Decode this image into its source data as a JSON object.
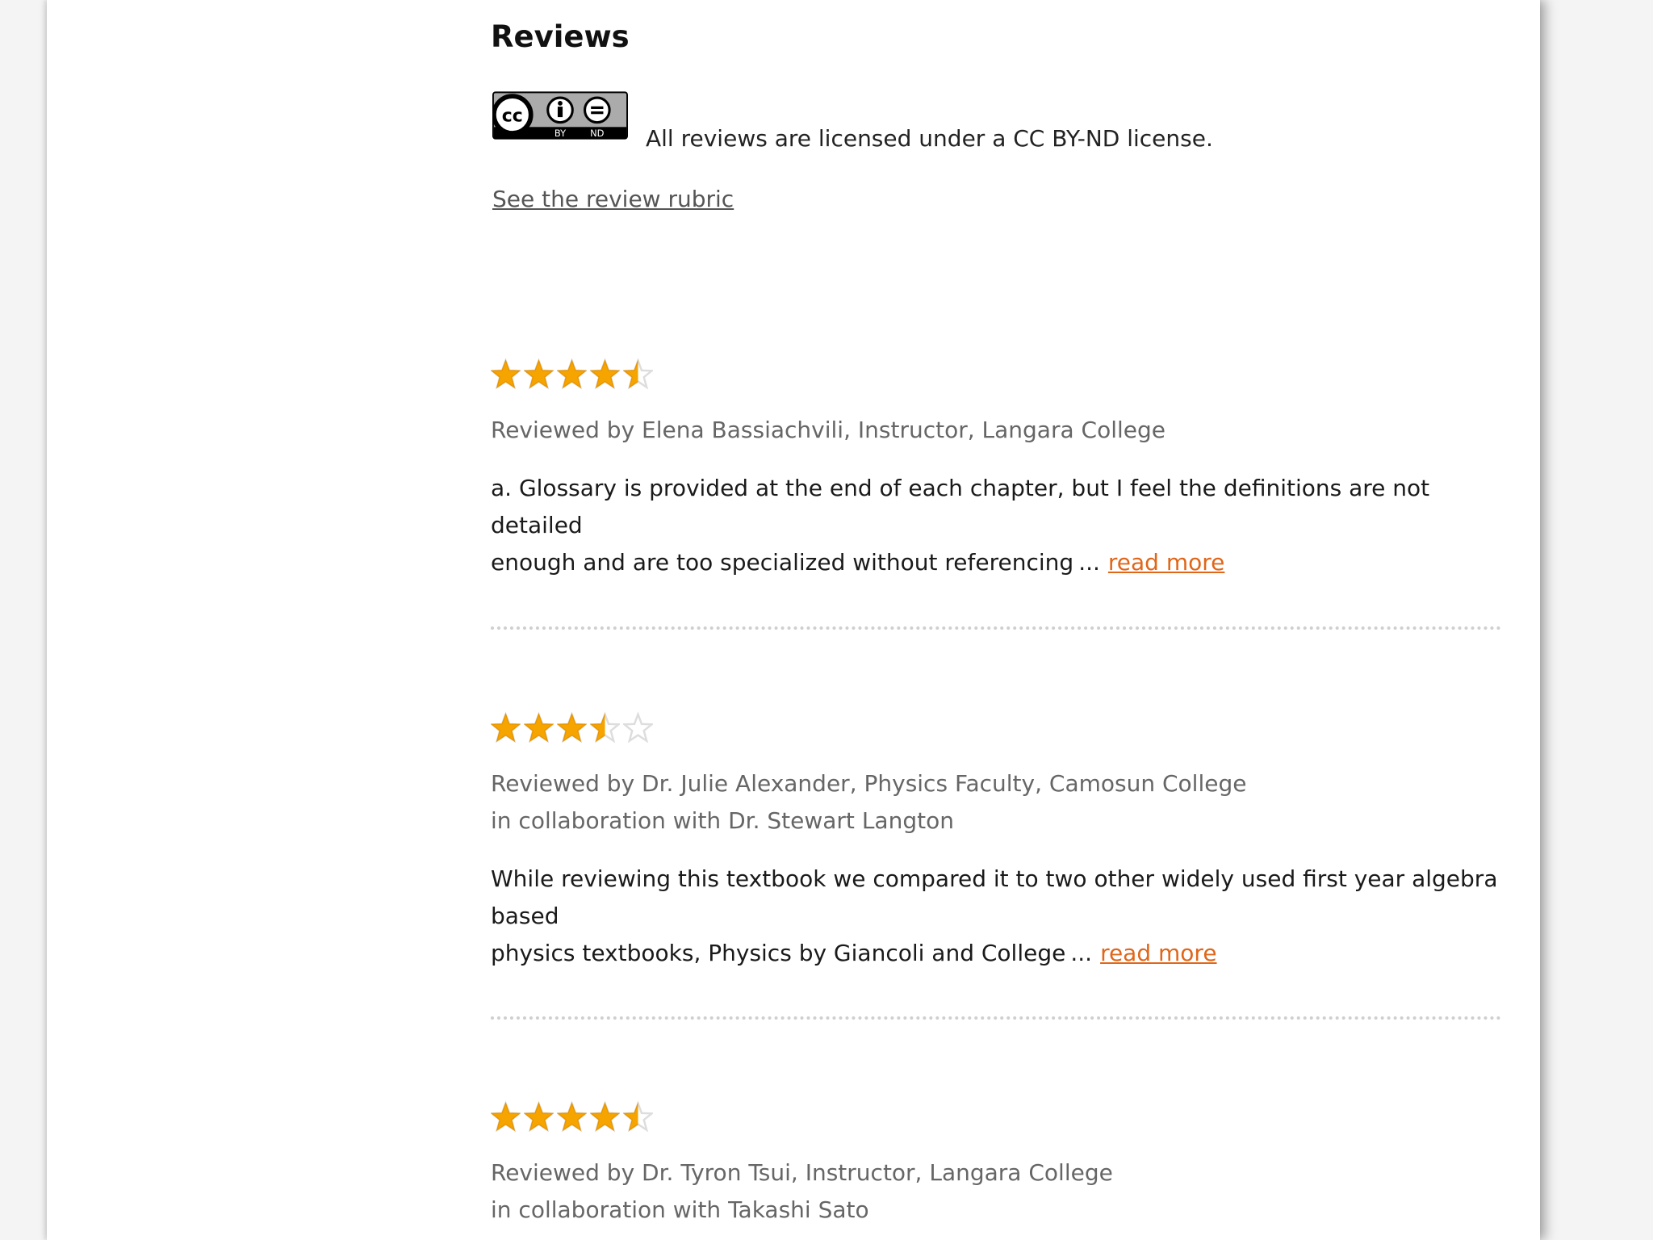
{
  "section": {
    "title": "Reviews"
  },
  "license": {
    "badge_icon": "cc-by-nd-license-badge",
    "badge_labels": [
      "BY",
      "ND"
    ],
    "text": "All reviews are licensed under a CC BY-ND license."
  },
  "rubric_link": "See the review rubric",
  "colors": {
    "star_filled": "#f5a400",
    "star_empty": "#dddddd",
    "link_accent": "#e0661a"
  },
  "reviews": [
    {
      "rating": 4.5,
      "reviewer": "Reviewed by Elena Bassiachvili, Instructor, Langara College",
      "collaboration": "",
      "excerpt_lines": [
        "a. Glossary is provided at the end of each chapter, but I feel the definitions are not detailed",
        "enough and are too specialized without referencing"
      ],
      "ellipsis": "...",
      "read_more": "read more"
    },
    {
      "rating": 3.5,
      "reviewer": "Reviewed by Dr. Julie Alexander, Physics Faculty, Camosun College",
      "collaboration": "in collaboration with Dr. Stewart Langton",
      "excerpt_lines": [
        "While reviewing this textbook we compared it to two other widely used first year algebra based",
        "physics textbooks, Physics by Giancoli and College"
      ],
      "ellipsis": "...",
      "read_more": "read more"
    },
    {
      "rating": 4.5,
      "reviewer": "Reviewed by Dr. Tyron Tsui, Instructor, Langara College",
      "collaboration": "in collaboration with Takashi Sato",
      "excerpt_lines": [],
      "ellipsis": "",
      "read_more": ""
    }
  ]
}
